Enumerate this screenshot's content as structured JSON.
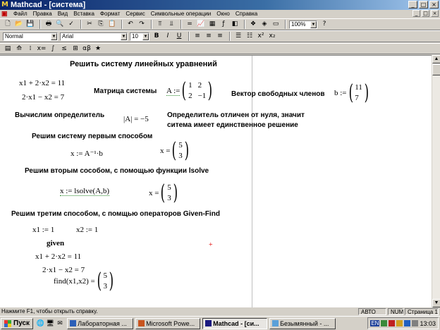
{
  "window": {
    "title": "Mathcad - [система]",
    "controls": [
      "_",
      "□",
      "×"
    ]
  },
  "menu": {
    "items": [
      "Файл",
      "Правка",
      "Вид",
      "Вставка",
      "Формат",
      "Сервис",
      "Символьные операции",
      "Окно",
      "Справка"
    ],
    "mdi_controls": [
      "_",
      "□",
      "×"
    ]
  },
  "toolbar": {
    "zoom": "100%",
    "style": "Normal",
    "font": "Arial",
    "size": "10",
    "bold": "B",
    "italic": "I",
    "underline": "U"
  },
  "doc": {
    "heading": "Решить систему линейных уравнений",
    "eq1": "x1 + 2·x2 = 11",
    "eq2": "2·x1 − x2 = 7",
    "matrix_label": "Матрица системы",
    "matrix_def": "A :=",
    "matrix": [
      "1",
      "2",
      "2",
      "−1"
    ],
    "vector_label": "Вектор свободных членов",
    "vector_def": "b :=",
    "vector": [
      "11",
      "7"
    ],
    "det_label": "Вычислим определитель",
    "det_expr": "|A| = −5",
    "det_note_1": "Определитель отличен от нуля, значит",
    "det_note_2": "ситема имеет единственное решение",
    "method1_label": "Решим систему первым способом",
    "method1_expr": "x := A⁻¹·b",
    "method1_result_def": "x =",
    "method1_result": [
      "5",
      "3"
    ],
    "method2_label": "Решим вторым сособом, с помощью функции lsolve",
    "method2_expr": "x := lsolve(A,b)",
    "method2_result_def": "x =",
    "method2_result": [
      "5",
      "3"
    ],
    "method3_label": "Решим третим способом, с помщью операторов Given-Find",
    "init1": "x1 := 1",
    "init2": "x2 := 1",
    "given": "given",
    "g_eq1": "x1 + 2·x2 = 11",
    "g_eq2": "2·x1 − x2 = 7",
    "find_def": "find(x1,x2) =",
    "find_result": [
      "5",
      "3"
    ],
    "cursor": "+"
  },
  "status": {
    "hint": "Нажмите F1, чтобы открыть справку.",
    "mode": "АВТО",
    "num": "NUM",
    "page": "Страница 1"
  },
  "taskbar": {
    "start": "Пуск",
    "tasks": [
      "Лабораторная ...",
      "Microsoft Powe...",
      "Mathcad - [си...",
      "Безымянный - ..."
    ],
    "lang": "EN",
    "clock": "13:03"
  },
  "colors": {
    "title_start": "#0a246a",
    "title_end": "#a6caf0",
    "cursor": "#e00000"
  }
}
